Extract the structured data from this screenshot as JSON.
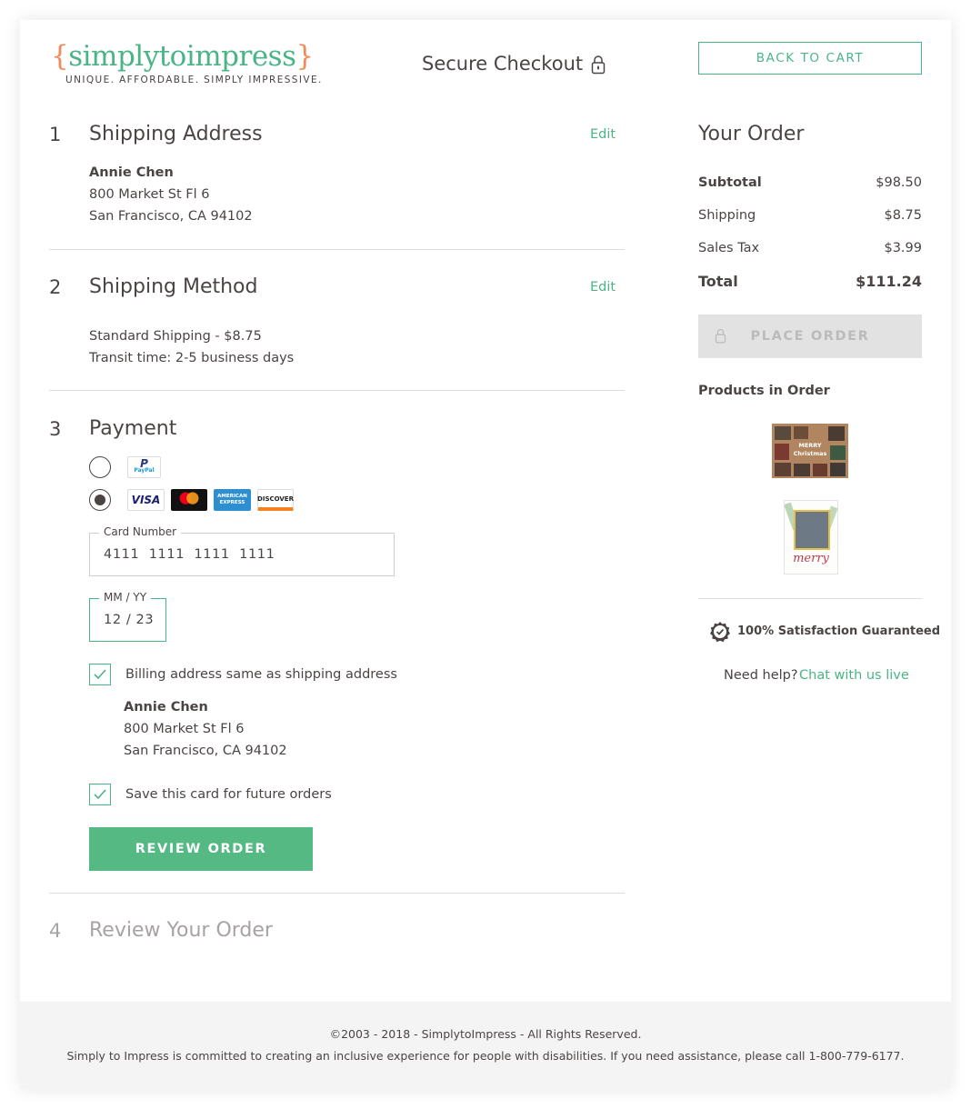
{
  "header": {
    "logo_open_brace": "{",
    "logo_text": "simplytoimpress",
    "logo_close_brace": "}",
    "logo_tagline": "UNIQUE. AFFORDABLE. SIMPLY IMPRESSIVE.",
    "secure_checkout": "Secure Checkout",
    "back_to_cart": "BACK TO CART"
  },
  "steps": {
    "shipping_address": {
      "number": "1",
      "title": "Shipping Address",
      "edit": "Edit",
      "name": "Annie Chen",
      "street": "800 Market St Fl 6",
      "city": "San Francisco, CA 94102"
    },
    "shipping_method": {
      "number": "2",
      "title": "Shipping Method",
      "edit": "Edit",
      "method": "Standard Shipping - $8.75",
      "transit": "Transit time: 2-5 business days"
    },
    "payment": {
      "number": "3",
      "title": "Payment",
      "paypal_label": "PayPal",
      "card_brands": [
        "VISA",
        "mastercard",
        "AMERICAN EXPRESS",
        "DISCOVER"
      ],
      "selected_method": "card",
      "card_number_label": "Card Number",
      "card_number_value": "4111  1111  1111  1111",
      "expiry_label": "MM / YY",
      "expiry_value": "12 / 23",
      "billing_same_label": "Billing address same as shipping address",
      "billing_same_checked": true,
      "billing_name": "Annie Chen",
      "billing_street": "800 Market St Fl 6",
      "billing_city": "San Francisco, CA 94102",
      "save_card_label": "Save this card for future orders",
      "save_card_checked": true,
      "review_button": "REVIEW ORDER"
    },
    "review": {
      "number": "4",
      "title": "Review Your Order"
    }
  },
  "order": {
    "title": "Your Order",
    "subtotal_label": "Subtotal",
    "subtotal_value": "$98.50",
    "shipping_label": "Shipping",
    "shipping_value": "$8.75",
    "tax_label": "Sales Tax",
    "tax_value": "$3.99",
    "total_label": "Total",
    "total_value": "$111.24",
    "place_order": "PLACE ORDER",
    "products_title": "Products in Order",
    "product_1_text": "MERRY Christmas",
    "product_2_text": "merry",
    "guarantee": "100% Satisfaction Guaranteed",
    "help_text": "Need help?",
    "help_link": "Chat with us live"
  },
  "footer": {
    "copyright": "©2003 - 2018 - SimplytoImpress - All Rights Reserved.",
    "accessibility": "Simply to Impress is committed to creating an inclusive experience for people with disabilities. If you need assistance, please call 1-800-779-6177."
  },
  "colors": {
    "accent": "#4bb487",
    "brace": "#f08c5a",
    "text": "#4a4443",
    "button_disabled": "#e2e2e2"
  }
}
